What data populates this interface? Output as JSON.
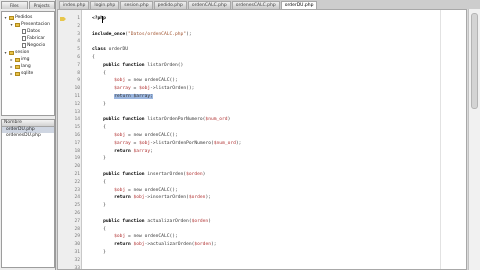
{
  "left_tabs": [
    "Files",
    "Projects"
  ],
  "tree": {
    "items": [
      {
        "label": "Pedidos",
        "level": 0,
        "type": "folder",
        "open": true
      },
      {
        "label": "Presentacion",
        "level": 1,
        "type": "folder",
        "open": true
      },
      {
        "label": "Datos",
        "level": 2,
        "type": "file"
      },
      {
        "label": "Fabricar",
        "level": 2,
        "type": "file"
      },
      {
        "label": "Negocio",
        "level": 2,
        "type": "file"
      },
      {
        "label": "sesion",
        "level": 0,
        "type": "folder",
        "open": true
      },
      {
        "label": "img",
        "level": 1,
        "type": "folder"
      },
      {
        "label": "lang",
        "level": 1,
        "type": "folder"
      },
      {
        "label": "sqlite",
        "level": 1,
        "type": "folder"
      }
    ]
  },
  "bottom_panel": {
    "header": "Nombre",
    "items": [
      "orderDU.php",
      "ordenesDU.php"
    ]
  },
  "file_tabs": [
    "index.php",
    "login.php",
    "sesion.php",
    "pedido.php",
    "ordenCALC.php",
    "ordenesCALC.php",
    "orderDU.php"
  ],
  "active_tab_index": 6,
  "gutter": {
    "line_numbers": [
      "1",
      "2",
      "3",
      "4",
      "5",
      "6",
      "7",
      "8",
      "9",
      "10",
      "11",
      "12",
      "13",
      "14",
      "15",
      "16",
      "17",
      "18",
      "19",
      "20",
      "21",
      "22",
      "23",
      "24",
      "25",
      "26",
      "27",
      "28",
      "29",
      "30",
      "31",
      "32",
      "33"
    ],
    "current_line_marker": "arrow-icon"
  },
  "code": {
    "lines": [
      {
        "segments": [
          {
            "t": "<?php",
            "c": "kw"
          }
        ]
      },
      {
        "segments": []
      },
      {
        "segments": [
          {
            "t": "include_once",
            "c": "kw"
          },
          {
            "t": "(",
            "c": ""
          },
          {
            "t": "\"Datos/ordenCALC.php\"",
            "c": "str"
          },
          {
            "t": ");",
            "c": ""
          }
        ]
      },
      {
        "segments": []
      },
      {
        "segments": [
          {
            "t": "class",
            "c": "kw"
          },
          {
            "t": " orderDU",
            "c": ""
          }
        ]
      },
      {
        "segments": [
          {
            "t": "{",
            "c": ""
          }
        ]
      },
      {
        "segments": [
          {
            "t": "    public function ",
            "c": "kw"
          },
          {
            "t": "listarOrden()",
            "c": ""
          }
        ]
      },
      {
        "segments": [
          {
            "t": "    {",
            "c": ""
          }
        ]
      },
      {
        "segments": [
          {
            "t": "        ",
            "c": ""
          },
          {
            "t": "$obj",
            "c": "var"
          },
          {
            "t": " = new ordenCALC();",
            "c": ""
          }
        ]
      },
      {
        "segments": [
          {
            "t": "        ",
            "c": ""
          },
          {
            "t": "$array",
            "c": "var"
          },
          {
            "t": " = ",
            "c": ""
          },
          {
            "t": "$obj",
            "c": "var"
          },
          {
            "t": "->listarOrden();",
            "c": ""
          }
        ]
      },
      {
        "segments": [
          {
            "t": "        ",
            "c": ""
          },
          {
            "t": "return $array;",
            "c": "hl"
          }
        ]
      },
      {
        "segments": [
          {
            "t": "    }",
            "c": ""
          }
        ]
      },
      {
        "segments": []
      },
      {
        "segments": [
          {
            "t": "    public function ",
            "c": "kw"
          },
          {
            "t": "listarOrdenPorNumero(",
            "c": ""
          },
          {
            "t": "$num_ord",
            "c": "var"
          },
          {
            "t": ")",
            "c": ""
          }
        ]
      },
      {
        "segments": [
          {
            "t": "    {",
            "c": ""
          }
        ]
      },
      {
        "segments": [
          {
            "t": "        ",
            "c": ""
          },
          {
            "t": "$obj",
            "c": "var"
          },
          {
            "t": " = new ordenCALC();",
            "c": ""
          }
        ]
      },
      {
        "segments": [
          {
            "t": "        ",
            "c": ""
          },
          {
            "t": "$array",
            "c": "var"
          },
          {
            "t": " = ",
            "c": ""
          },
          {
            "t": "$obj",
            "c": "var"
          },
          {
            "t": "->listarOrdenPorNumero(",
            "c": ""
          },
          {
            "t": "$num_ord",
            "c": "var"
          },
          {
            "t": ");",
            "c": ""
          }
        ]
      },
      {
        "segments": [
          {
            "t": "        return ",
            "c": "kw"
          },
          {
            "t": "$array",
            "c": "var"
          },
          {
            "t": ";",
            "c": ""
          }
        ]
      },
      {
        "segments": [
          {
            "t": "    }",
            "c": ""
          }
        ]
      },
      {
        "segments": []
      },
      {
        "segments": [
          {
            "t": "    public function ",
            "c": "kw"
          },
          {
            "t": "insertarOrden(",
            "c": ""
          },
          {
            "t": "$orden",
            "c": "var"
          },
          {
            "t": ")",
            "c": ""
          }
        ]
      },
      {
        "segments": [
          {
            "t": "    {",
            "c": ""
          }
        ]
      },
      {
        "segments": [
          {
            "t": "        ",
            "c": ""
          },
          {
            "t": "$obj",
            "c": "var"
          },
          {
            "t": " = new ordenCALC();",
            "c": ""
          }
        ]
      },
      {
        "segments": [
          {
            "t": "        return ",
            "c": "kw"
          },
          {
            "t": "$obj",
            "c": "var"
          },
          {
            "t": "->insertarOrden(",
            "c": ""
          },
          {
            "t": "$orden",
            "c": "var"
          },
          {
            "t": ");",
            "c": ""
          }
        ]
      },
      {
        "segments": [
          {
            "t": "    }",
            "c": ""
          }
        ]
      },
      {
        "segments": []
      },
      {
        "segments": [
          {
            "t": "    public function ",
            "c": "kw"
          },
          {
            "t": "actualizarOrden(",
            "c": ""
          },
          {
            "t": "$orden",
            "c": "var"
          },
          {
            "t": ")",
            "c": ""
          }
        ]
      },
      {
        "segments": [
          {
            "t": "    {",
            "c": ""
          }
        ]
      },
      {
        "segments": [
          {
            "t": "        ",
            "c": ""
          },
          {
            "t": "$obj",
            "c": "var"
          },
          {
            "t": " = new ordenCALC();",
            "c": ""
          }
        ]
      },
      {
        "segments": [
          {
            "t": "        return ",
            "c": "kw"
          },
          {
            "t": "$obj",
            "c": "var"
          },
          {
            "t": "->actualizarOrden(",
            "c": ""
          },
          {
            "t": "$orden",
            "c": "var"
          },
          {
            "t": ");",
            "c": ""
          }
        ]
      },
      {
        "segments": [
          {
            "t": "    }",
            "c": ""
          }
        ]
      },
      {
        "segments": []
      },
      {
        "segments": []
      }
    ]
  },
  "colors": {
    "selection": "#9bb6df",
    "variable": "#b03030",
    "string": "#a0522d",
    "marker": "#e7c64b"
  }
}
